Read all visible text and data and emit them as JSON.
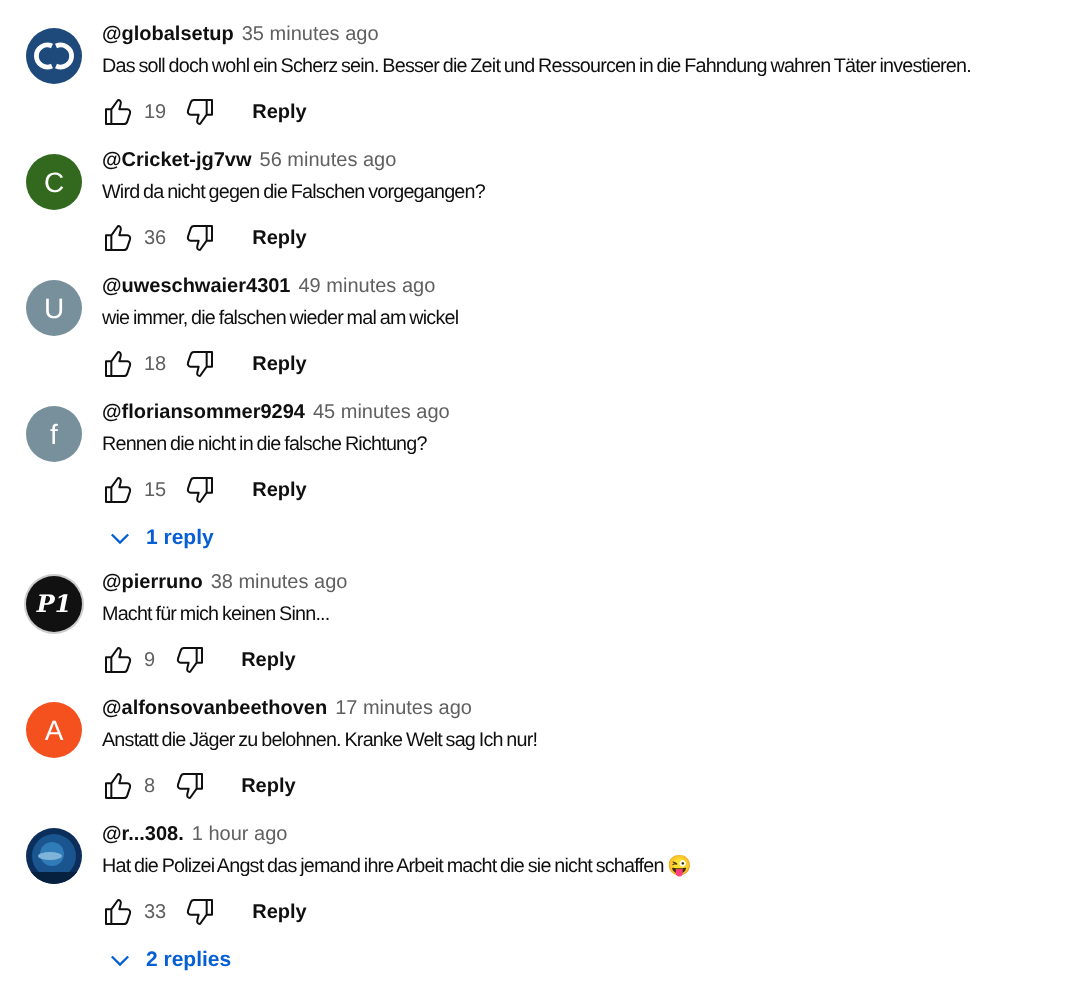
{
  "comments": [
    {
      "author": "@globalsetup",
      "time": "35 minutes ago",
      "text": "Das soll doch wohl ein Scherz sein. Besser die Zeit und Ressourcen in die Fahndung wahren Täter investieren.",
      "likes": "19",
      "reply_label": "Reply",
      "avatar": {
        "kind": "logo",
        "color": "#1d4a7a"
      }
    },
    {
      "author": "@Cricket-jg7vw",
      "time": "56 minutes ago",
      "text": "Wird da nicht gegen die Falschen vorgegangen?",
      "likes": "36",
      "reply_label": "Reply",
      "avatar": {
        "kind": "letter",
        "letter": "C",
        "color": "#33691e"
      }
    },
    {
      "author": "@uweschwaier4301",
      "time": "49 minutes ago",
      "text": "wie immer, die falschen wieder mal am wickel",
      "likes": "18",
      "reply_label": "Reply",
      "avatar": {
        "kind": "letter",
        "letter": "U",
        "color": "#78909c"
      }
    },
    {
      "author": "@floriansommer9294",
      "time": "45 minutes ago",
      "text": "Rennen die nicht in die falsche Richtung?",
      "likes": "15",
      "reply_label": "Reply",
      "avatar": {
        "kind": "letter",
        "letter": "f",
        "color": "#78909c"
      },
      "replies_toggle": "1 reply"
    },
    {
      "author": "@pierruno",
      "time": "38 minutes ago",
      "text": "Macht für mich keinen Sinn...",
      "likes": "9",
      "reply_label": "Reply",
      "avatar": {
        "kind": "monogram",
        "letter": "P1",
        "color": "#111111"
      }
    },
    {
      "author": "@alfonsovanbeethoven",
      "time": "17 minutes ago",
      "text": "Anstatt die Jäger zu belohnen. Kranke Welt sag Ich nur!",
      "likes": "8",
      "reply_label": "Reply",
      "avatar": {
        "kind": "letter",
        "letter": "A",
        "color": "#f4511e"
      }
    },
    {
      "author": "@r...308.",
      "time": "1 hour ago",
      "text": "Hat die Polizei Angst das jemand ihre Arbeit macht die sie nicht schaffen 😜",
      "likes": "33",
      "reply_label": "Reply",
      "replies_toggle": "2 replies"
    }
  ]
}
